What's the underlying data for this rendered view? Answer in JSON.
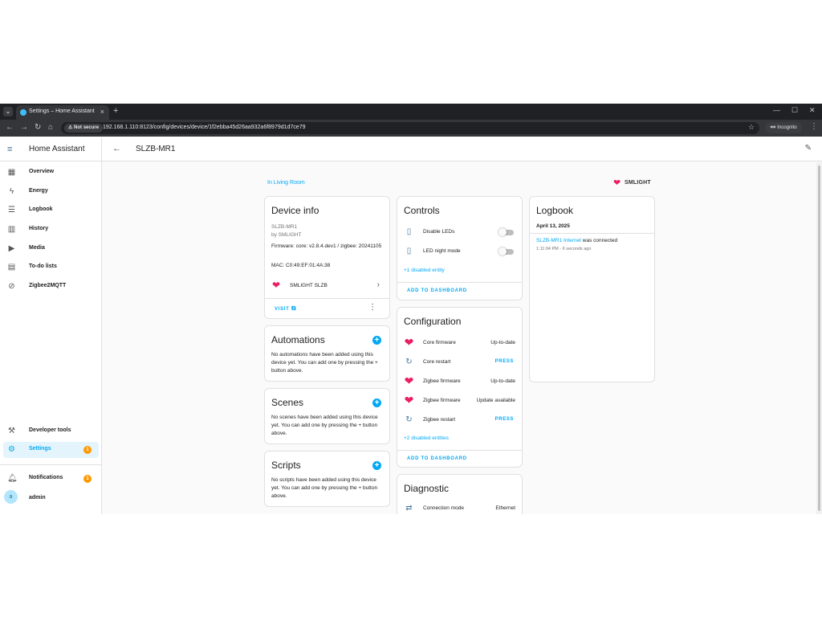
{
  "browser": {
    "tab_title": "Settings – Home Assistant",
    "not_secure": "Not secure",
    "url": "192.168.1.110:8123/config/devices/device/1f2ebba45d26aa932a6f8979d1d7ce79",
    "incognito": "Incognito"
  },
  "sidebar": {
    "title": "Home Assistant",
    "items": [
      {
        "label": "Overview",
        "icon": "grid-icon"
      },
      {
        "label": "Energy",
        "icon": "lightning-icon"
      },
      {
        "label": "Logbook",
        "icon": "list-icon"
      },
      {
        "label": "History",
        "icon": "chart-icon"
      },
      {
        "label": "Media",
        "icon": "media-icon"
      },
      {
        "label": "To-do lists",
        "icon": "clipboard-icon"
      },
      {
        "label": "Zigbee2MQTT",
        "icon": "zigbee-icon"
      }
    ],
    "developer_tools": "Developer tools",
    "settings": "Settings",
    "settings_badge": "1",
    "notifications": "Notifications",
    "notifications_badge": "1",
    "user_initial": "a",
    "user_name": "admin",
    "accent_color": "#03a9f4"
  },
  "header": {
    "title": "SLZB-MR1"
  },
  "area_link": "In Living Room",
  "brand": "SMLIGHT",
  "device_info": {
    "title": "Device info",
    "model": "SLZB-MR1",
    "manufacturer": "by SMLIGHT",
    "firmware": "Firmware: core: v2.8.4.dev1 / zigbee: 20241105",
    "mac": "MAC: C0:49:EF:01:4A:38",
    "integration": "SMLIGHT SLZB",
    "visit": "VISIT"
  },
  "automations": {
    "title": "Automations",
    "text": "No automations have been added using this device yet. You can add one by pressing the + button above."
  },
  "scenes": {
    "title": "Scenes",
    "text": "No scenes have been added using this device yet. You can add one by pressing the + button above."
  },
  "scripts": {
    "title": "Scripts",
    "text": "No scripts have been added using this device yet. You can add one by pressing the + button above."
  },
  "controls": {
    "title": "Controls",
    "items": [
      {
        "label": "Disable LEDs",
        "state": "off"
      },
      {
        "label": "LED night mode",
        "state": "off"
      }
    ],
    "disabled_link": "+1 disabled entity",
    "add_to_dashboard": "ADD TO DASHBOARD"
  },
  "configuration": {
    "title": "Configuration",
    "items": [
      {
        "label": "Core firmware",
        "value": "Up-to-date"
      },
      {
        "label": "Core restart",
        "value": "PRESS"
      },
      {
        "label": "Zigbee firmware",
        "value": "Up-to-date"
      },
      {
        "label": "Zigbee firmware",
        "value": "Update available"
      },
      {
        "label": "Zigbee restart",
        "value": "PRESS"
      }
    ],
    "disabled_link": "+2 disabled entities",
    "add_to_dashboard": "ADD TO DASHBOARD"
  },
  "diagnostic": {
    "title": "Diagnostic",
    "items": [
      {
        "label": "Connection mode",
        "value": "Ethernet"
      }
    ]
  },
  "logbook": {
    "title": "Logbook",
    "date": "April 13, 2025",
    "entry_link": "SLZB-MR1 Internet",
    "entry_text": " was connected",
    "entry_time": "1:11:04 PM - 6 seconds ago"
  }
}
